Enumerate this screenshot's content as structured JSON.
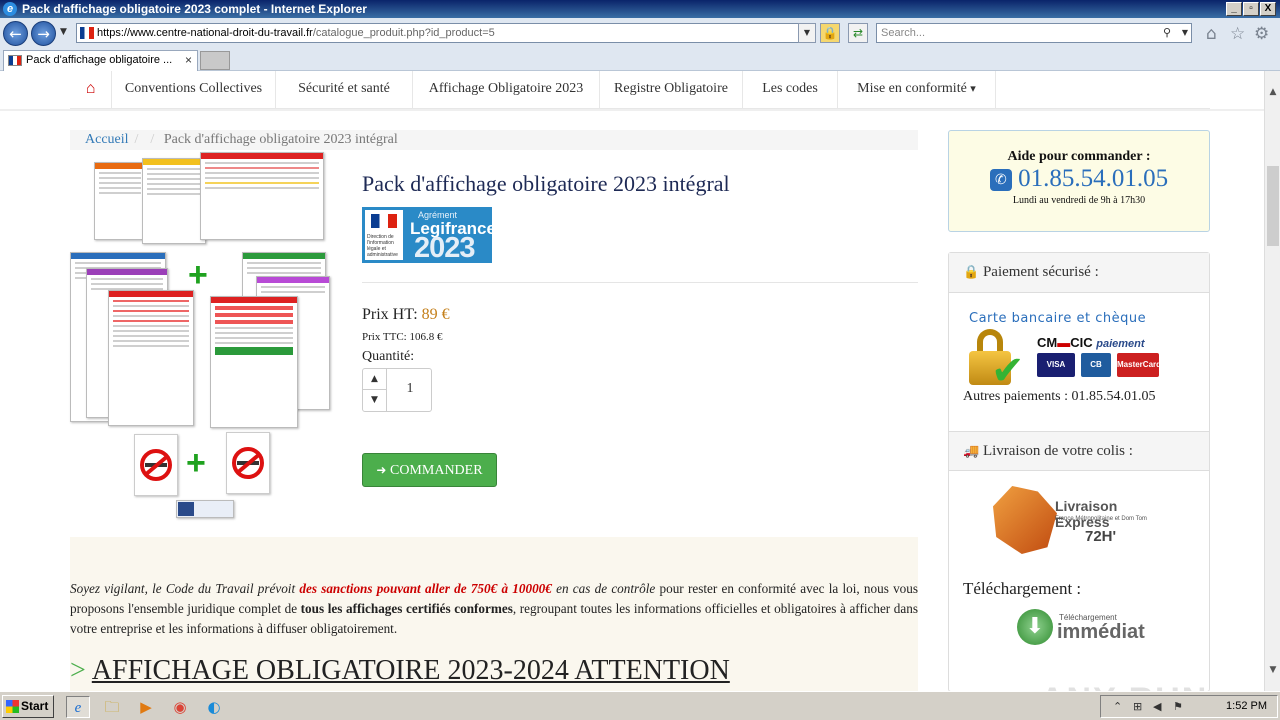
{
  "window": {
    "title": "Pack d'affichage obligatoire 2023 complet - Internet Explorer",
    "minimize": "_",
    "restore": "▫",
    "close": "X"
  },
  "browser": {
    "url_host": "https://www.centre-national-droit-du-travail.fr",
    "url_path": "/catalogue_produit.php?id_product=5",
    "search_placeholder": "Search...",
    "tab_label": "Pack d'affichage obligatoire ...",
    "tab_close": "×"
  },
  "site_nav": {
    "home_icon": "home-icon",
    "items": [
      "Conventions Collectives",
      "Sécurité et santé",
      "Affichage Obligatoire 2023",
      "Registre Obligatoire",
      "Les codes",
      "Mise en conformité"
    ],
    "dropdown_caret": "▾"
  },
  "breadcrumb": {
    "home": "Accueil",
    "sep": "/",
    "current": "Pack d'affichage obligatoire 2023 intégral"
  },
  "product": {
    "title": "Pack d'affichage obligatoire 2023 intégral",
    "badge": {
      "agrement": "Agrément",
      "brand": "Legifrance",
      "year": "2023",
      "republique_text": "Direction de l'information légale et administrative"
    },
    "price_ht_label": "Prix HT:",
    "price_ht_value": "89 €",
    "price_ttc": "Prix TTC: 106.8 €",
    "quantity_label": "Quantité:",
    "quantity_value": "1",
    "order_button": "COMMANDER",
    "order_icon": "arrow-circle-right-icon"
  },
  "description": {
    "p1_italic1": "Soyez vigilant, le Code du Travail prévoit ",
    "p1_red": "des sanctions pouvant aller de 750€ à 10000€",
    "p1_italic2": " en cas de contrôle",
    "p1_rest1": " pour rester en conformité avec la loi, nous vous proposons l'ensemble juridique complet de ",
    "p1_bold": "tous les affichages certifiés conformes",
    "p1_rest2": ", regroupant toutes les informations officielles et obligatoires à afficher dans votre entreprise et les informations à diffuser obligatoirement.",
    "heading_marker": ">",
    "heading": "AFFICHAGE OBLIGATOIRE 2023-2024 ATTENTION"
  },
  "sidebar": {
    "help_title": "Aide pour commander :",
    "help_phone": "01.85.54.01.05",
    "help_hours": "Lundi au vendredi de 9h à 17h30",
    "payment_header": "Paiement sécurisé :",
    "card_title": "Carte bancaire et chèque",
    "cmcic": "CM",
    "cmcic2": "CIC",
    "cmcic_paiement": "paiement",
    "cards": [
      "VISA",
      "CB",
      "MasterCard"
    ],
    "other_payments": "Autres paiements : 01.85.54.01.05",
    "delivery_header": "Livraison de votre colis :",
    "delivery_logo_title": "Livraison Express",
    "delivery_logo_sub": "France Métropolitaine et Dom Tom",
    "delivery_logo_time": "72H'",
    "download_title": "Téléchargement :",
    "download_small": "Téléchargement",
    "download_large": "immédiat"
  },
  "taskbar": {
    "start": "Start",
    "clock": "1:52 PM"
  },
  "watermark": "ANY RUN",
  "colors": {
    "nav_home": "#cc0000",
    "order_button": "#4cae4c",
    "price": "#c47f1a",
    "phone": "#2a6ebb",
    "legifrance_blue": "#2a8ac7"
  }
}
